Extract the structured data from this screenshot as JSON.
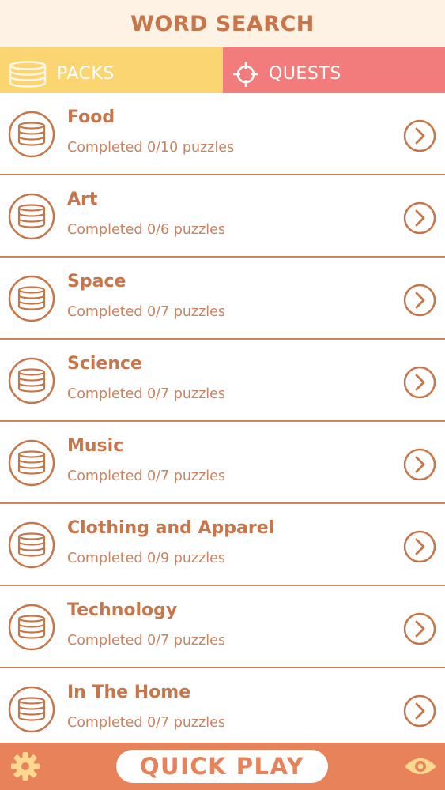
{
  "header": {
    "title": "WORD SEARCH"
  },
  "tabs": [
    {
      "label": "PACKS",
      "icon": "coins-icon",
      "selected": true
    },
    {
      "label": "QUESTS",
      "icon": "crosshair-icon",
      "selected": false
    }
  ],
  "packs": [
    {
      "name": "Food",
      "progress": "Completed 0/10 puzzles"
    },
    {
      "name": "Art",
      "progress": "Completed 0/6 puzzles"
    },
    {
      "name": "Space",
      "progress": "Completed 0/7 puzzles"
    },
    {
      "name": "Science",
      "progress": "Completed 0/7 puzzles"
    },
    {
      "name": "Music",
      "progress": "Completed 0/7 puzzles"
    },
    {
      "name": "Clothing and Apparel",
      "progress": "Completed 0/9 puzzles"
    },
    {
      "name": "Technology",
      "progress": "Completed 0/7 puzzles"
    },
    {
      "name": "In The Home",
      "progress": "Completed 0/7 puzzles"
    }
  ],
  "footer": {
    "quick_play_label": "QUICK PLAY",
    "left_icon": "gear-icon",
    "right_icon": "eye-icon"
  },
  "colors": {
    "accent": "#c8754a",
    "packs_tab": "#fcd573",
    "quests_tab": "#f27b7b",
    "footer": "#e8825a",
    "header_bg": "#fdf2e3"
  }
}
